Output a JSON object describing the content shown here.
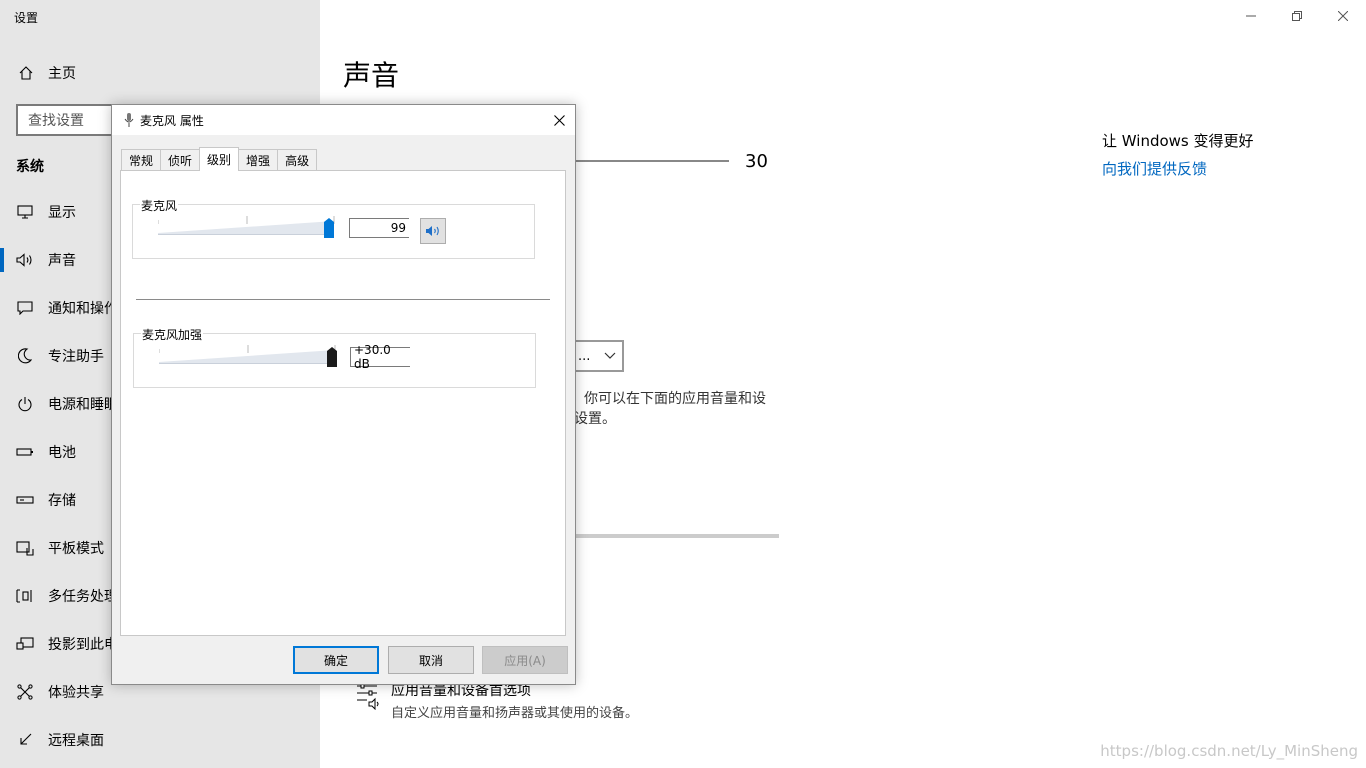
{
  "app": {
    "title": "设置"
  },
  "sidebar": {
    "home_label": "主页",
    "search_placeholder": "查找设置",
    "section_title": "系统",
    "items": [
      {
        "label": "显示",
        "icon": "monitor-icon"
      },
      {
        "label": "声音",
        "icon": "speaker-icon",
        "active": true
      },
      {
        "label": "通知和操作",
        "icon": "notification-icon"
      },
      {
        "label": "专注助手",
        "icon": "moon-icon"
      },
      {
        "label": "电源和睡眠",
        "icon": "power-icon"
      },
      {
        "label": "电池",
        "icon": "battery-icon"
      },
      {
        "label": "存储",
        "icon": "storage-icon"
      },
      {
        "label": "平板模式",
        "icon": "tablet-icon"
      },
      {
        "label": "多任务处理",
        "icon": "multitask-icon"
      },
      {
        "label": "投影到此电脑",
        "icon": "project-icon"
      },
      {
        "label": "体验共享",
        "icon": "share-icon"
      },
      {
        "label": "远程桌面",
        "icon": "remote-icon"
      }
    ]
  },
  "main": {
    "title": "声音",
    "volume_value": "30",
    "dropdown_text": "...",
    "desc_line1": "你可以在下面的应用音量和设",
    "desc_line2": "设置。",
    "mixer_title": "应用音量和设备首选项",
    "mixer_desc": "自定义应用音量和扬声器或其使用的设备。"
  },
  "related": {
    "title": "让 Windows 变得更好",
    "link": "向我们提供反馈"
  },
  "watermark": "https://blog.csdn.net/Ly_MinSheng",
  "dialog": {
    "title": "麦克风 属性",
    "tabs": [
      "常规",
      "侦听",
      "级别",
      "增强",
      "高级"
    ],
    "active_tab": "级别",
    "mic_group_label": "麦克风",
    "mic_value": "99",
    "mic_level": 0.99,
    "boost_group_label": "麦克风加强",
    "boost_value": "+30.0 dB",
    "boost_level": 1.0,
    "buttons": {
      "ok": "确定",
      "cancel": "取消",
      "apply": "应用(A)"
    }
  },
  "colors": {
    "accent": "#0067c0",
    "slider_thumb_mic": "#0078d7",
    "slider_thumb_boost": "#1a1a1a"
  }
}
